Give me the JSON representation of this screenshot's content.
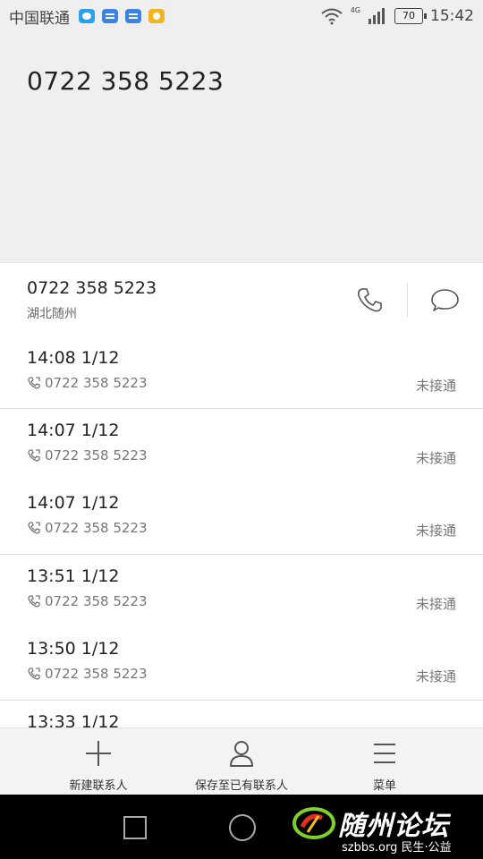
{
  "status_bar": {
    "carrier": "中国联通",
    "network": "4G",
    "battery": "70",
    "time": "15:42"
  },
  "header": {
    "number": "0722 358 5223"
  },
  "contact": {
    "number": "0722 358 5223",
    "location": "湖北随州"
  },
  "calls": [
    {
      "time": "14:08 1/12",
      "number": "0722 358 5223",
      "status": "未接通"
    },
    {
      "time": "14:07 1/12",
      "number": "0722 358 5223",
      "status": "未接通"
    },
    {
      "time": "14:07 1/12",
      "number": "0722 358 5223",
      "status": "未接通"
    },
    {
      "time": "13:51 1/12",
      "number": "0722 358 5223",
      "status": "未接通"
    },
    {
      "time": "13:50 1/12",
      "number": "0722 358 5223",
      "status": "未接通"
    },
    {
      "time": "13:33 1/12",
      "number": "",
      "status": ""
    }
  ],
  "bottom_bar": {
    "new_contact": "新建联系人",
    "save_existing": "保存至已有联系人",
    "menu": "菜单"
  },
  "watermark": {
    "title": "随州论坛",
    "subtitle": "szbbs.org 民生·公益"
  },
  "colors": {
    "header_bg": "#efefef",
    "watermark_green": "#7fd02a",
    "watermark_red": "#e03020"
  }
}
